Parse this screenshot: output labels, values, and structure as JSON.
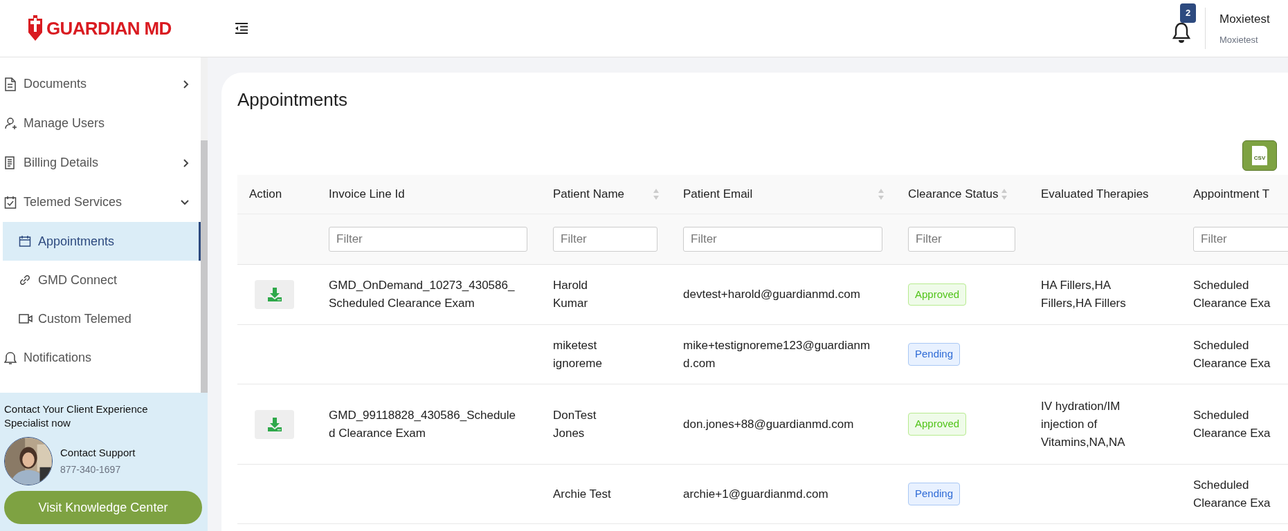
{
  "header": {
    "logo": "GUARDIAN MD",
    "notification_count": "2",
    "user_name": "Moxietest",
    "user_subtitle": "Moxietest"
  },
  "sidebar": {
    "items": [
      {
        "label": "Documents",
        "kind": "group",
        "expanded": false,
        "selected": false
      },
      {
        "label": "Manage Users",
        "kind": "link",
        "selected": false
      },
      {
        "label": "Billing Details",
        "kind": "group",
        "expanded": false,
        "selected": false
      },
      {
        "label": "Telemed Services",
        "kind": "group",
        "expanded": true,
        "selected": false,
        "children": [
          {
            "label": "Appointments",
            "selected": true
          },
          {
            "label": "GMD Connect",
            "selected": false
          },
          {
            "label": "Custom Telemed",
            "selected": false
          }
        ]
      },
      {
        "label": "Notifications",
        "kind": "link",
        "selected": false
      }
    ]
  },
  "contact": {
    "title": "Contact Your Client Experience Specialist now",
    "name": "Contact Support",
    "phone": "877-340-1697",
    "button": "Visit Knowledge Center"
  },
  "main": {
    "title": "Appointments",
    "csv_label": "CSV",
    "table": {
      "columns": [
        {
          "label": "Action",
          "sortable": false
        },
        {
          "label": "Invoice Line Id",
          "sortable": false,
          "filter_placeholder": "Filter"
        },
        {
          "label": "Patient Name",
          "sortable": true,
          "filter_placeholder": "Filter"
        },
        {
          "label": "Patient Email",
          "sortable": true,
          "filter_placeholder": "Filter"
        },
        {
          "label": "Clearance Status",
          "sortable": true,
          "filter_placeholder": "Filter"
        },
        {
          "label": "Evaluated Therapies",
          "sortable": false
        },
        {
          "label": "Appointment T",
          "sortable": false,
          "filter_placeholder": "Filter"
        }
      ],
      "rows": [
        {
          "downloadable": true,
          "invoice_line_id": "GMD_OnDemand_10273_430586_Scheduled Clearance Exam",
          "patient_name": "Harold Kumar",
          "patient_email": "devtest+harold@guardianmd.com",
          "clearance_status": {
            "label": "Approved",
            "kind": "approved"
          },
          "evaluated_therapies": "HA Fillers,HA Fillers,HA Fillers",
          "appointment_type": "Scheduled Clearance Exa"
        },
        {
          "downloadable": false,
          "patient_name": "miketest ignoreme",
          "patient_email": "mike+testignoreme123@guardianmd.com",
          "clearance_status": {
            "label": "Pending",
            "kind": "pending"
          },
          "appointment_type": "Scheduled Clearance Exa"
        },
        {
          "downloadable": true,
          "invoice_line_id": "GMD_99118828_430586_Scheduled Clearance Exam",
          "patient_name": "DonTest Jones",
          "patient_email": "don.jones+88@guardianmd.com",
          "clearance_status": {
            "label": "Approved",
            "kind": "approved"
          },
          "evaluated_therapies": "IV hydration/IM injection of Vitamins,NA,NA",
          "appointment_type": "Scheduled Clearance Exa"
        },
        {
          "downloadable": false,
          "patient_name": "Archie Test",
          "patient_email": "archie+1@guardianmd.com",
          "clearance_status": {
            "label": "Pending",
            "kind": "pending"
          },
          "appointment_type": "Scheduled Clearance Exa"
        }
      ]
    }
  }
}
